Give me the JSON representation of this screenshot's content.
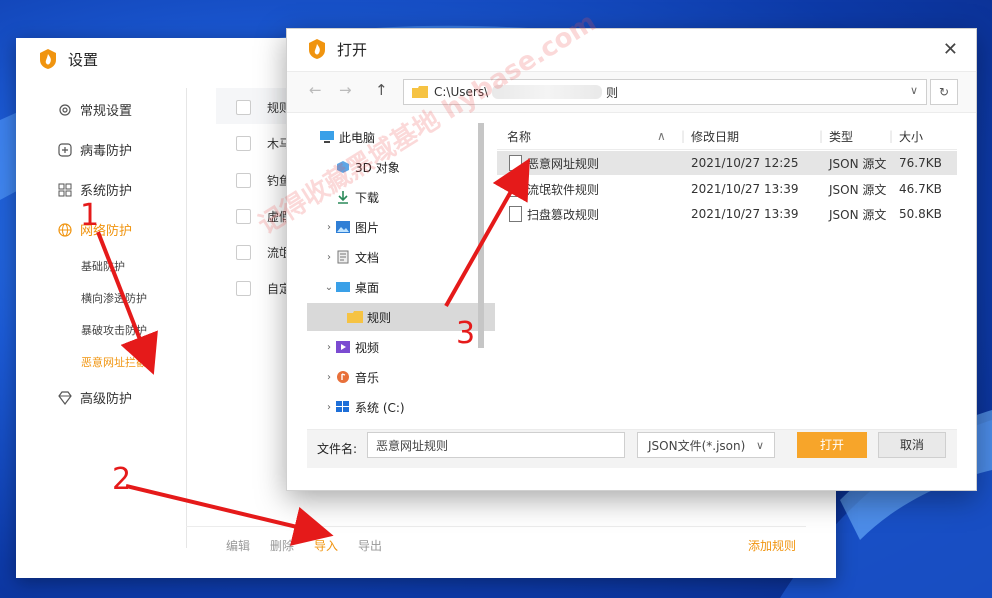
{
  "settings": {
    "title": "设置",
    "nav": [
      {
        "label": "常规设置",
        "icon": "gear-icon"
      },
      {
        "label": "病毒防护",
        "icon": "plus-square-icon"
      },
      {
        "label": "系统防护",
        "icon": "grid-icon"
      },
      {
        "label": "网络防护",
        "icon": "globe-icon",
        "active": true
      },
      {
        "label": "高级防护",
        "icon": "diamond-icon"
      }
    ],
    "subnav": [
      {
        "label": "基础防护"
      },
      {
        "label": "横向渗透防护"
      },
      {
        "label": "暴破攻击防护"
      },
      {
        "label": "恶意网址拦截",
        "active": true
      }
    ],
    "rows": [
      "规则",
      "木马",
      "钓鱼",
      "虚假",
      "流氓",
      "自定"
    ],
    "footer": {
      "edit": "编辑",
      "delete": "删除",
      "import": "导入",
      "export": "导出",
      "add_rule": "添加规则"
    }
  },
  "dialog": {
    "title": "打开",
    "address_prefix": "C:\\Users\\",
    "address_suffix": "则",
    "tree": [
      {
        "label": "此电脑",
        "icon": "computer-icon"
      },
      {
        "label": "3D 对象",
        "icon": "cube-icon"
      },
      {
        "label": "下载",
        "icon": "download-icon"
      },
      {
        "label": "图片",
        "icon": "picture-icon"
      },
      {
        "label": "文档",
        "icon": "document-icon"
      },
      {
        "label": "桌面",
        "icon": "desktop-icon"
      },
      {
        "label": "规则",
        "icon": "folder-icon"
      },
      {
        "label": "视频",
        "icon": "video-icon"
      },
      {
        "label": "音乐",
        "icon": "music-icon"
      },
      {
        "label": "系统 (C:)",
        "icon": "drive-icon"
      }
    ],
    "columns": {
      "name": "名称",
      "modified": "修改日期",
      "type": "类型",
      "size": "大小"
    },
    "files": [
      {
        "name": "恶意网址规则",
        "modified": "2021/10/27 12:25",
        "type": "JSON 源文",
        "size": "76.7KB"
      },
      {
        "name": "流氓软件规则",
        "modified": "2021/10/27 13:39",
        "type": "JSON 源文",
        "size": "46.7KB"
      },
      {
        "name": "扫盘篡改规则",
        "modified": "2021/10/27 13:39",
        "type": "JSON 源文",
        "size": "50.8KB"
      }
    ],
    "filename_label": "文件名:",
    "filename_value": "恶意网址规则",
    "filetype": "JSON文件(*.json)",
    "open_label": "打开",
    "cancel_label": "取消"
  },
  "annotations": {
    "n1": "1",
    "n2": "2",
    "n3": "3",
    "color": "#e51a1a"
  },
  "watermark": "记得收藏黑域基地 hybase.com",
  "colors": {
    "accent": "#f0940f",
    "open_button": "#f7a52a"
  }
}
